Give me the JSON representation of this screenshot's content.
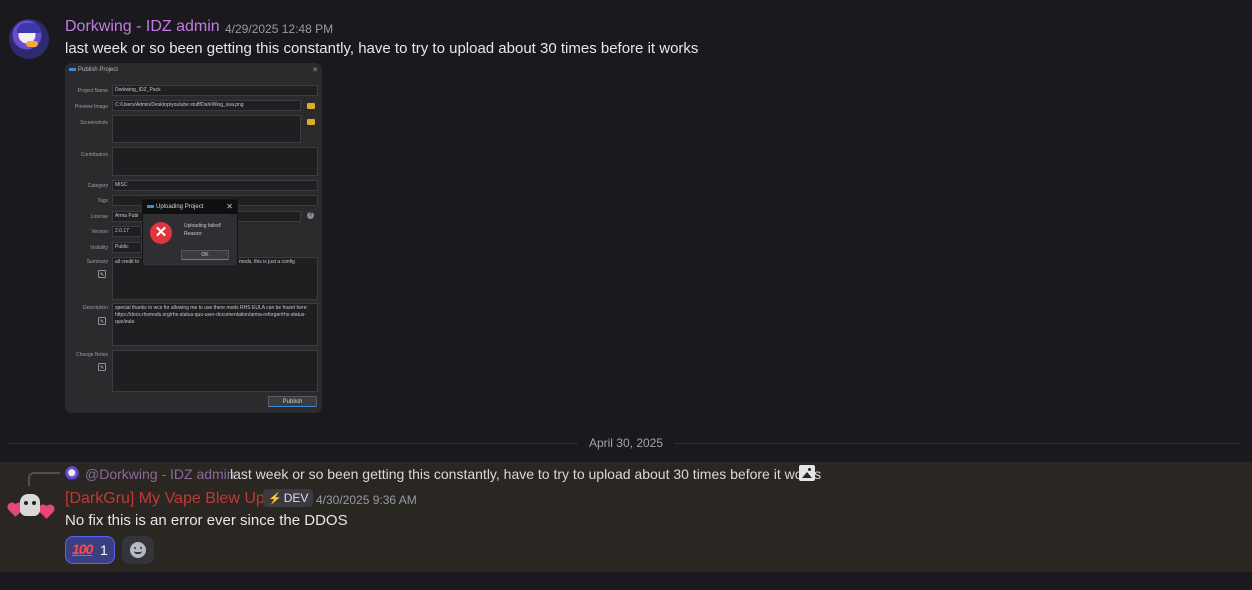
{
  "message1": {
    "username": "Dorkwing - IDZ admin",
    "timestamp": "4/29/2025 12:48 PM",
    "text": "last week or so been getting this constantly, have to try to upload about 30 times before it works",
    "attachment": {
      "window_title": "Publish Project",
      "fields": {
        "project_name_label": "Project Name",
        "project_name_value": "Dorkwing_IDZ_Pack",
        "preview_image_label": "Preview Image",
        "preview_image_value": "C:/Users/Admin/Desktop/youtube stuff/DarkWing_ava.png",
        "screenshots_label": "Screenshots",
        "contributors_label": "Contributors",
        "category_label": "Category",
        "category_value": "MISC",
        "tags_label": "Tags",
        "license_label": "License",
        "license_value": "Arma Publ",
        "version_label": "Version",
        "version_value": "2.0.17",
        "visibility_label": "Visibility",
        "visibility_value": "Public",
        "summary_label": "Summary",
        "summary_left": "all credit to",
        "summary_right": "mods, this is just a config",
        "description_label": "Description",
        "description_value": "special thanks to wcs for allowing me to use there mods RHS EULA can be found here: https://docs.rhsmods.org/rhs-status-quo-user-documentation/arma-reforger/rhs-status-quo/eula",
        "change_notes_label": "Change Notes"
      },
      "publish_button": "Publish",
      "dialog": {
        "title": "Uploading Project",
        "message_line1": "Uploading failed!",
        "message_line2": "Reason:",
        "ok_button": "OK"
      }
    }
  },
  "divider": {
    "date": "April 30, 2025"
  },
  "message2": {
    "reply": {
      "username": "@Dorkwing - IDZ admin",
      "text": "last week or so been getting this constantly, have to try to upload about 30 times before it works"
    },
    "username": "[DarkGru] My Vape Blew Up",
    "badge": "DEV",
    "timestamp": "4/30/2025 9:36 AM",
    "text": "No fix this is an error ever since the DDOS",
    "reactions": [
      {
        "emoji": "100",
        "count": "1"
      }
    ]
  }
}
